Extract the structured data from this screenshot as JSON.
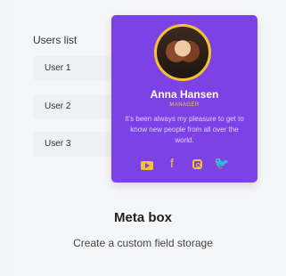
{
  "users_list": {
    "title": "Users list",
    "items": [
      {
        "label": "User 1"
      },
      {
        "label": "User 2"
      },
      {
        "label": "User 3"
      }
    ]
  },
  "profile": {
    "name": "Anna Hansen",
    "role": "MANAGER",
    "bio": "It's been always my pleasure to get to know new people from all over the world.",
    "socials": [
      "youtube-icon",
      "facebook-icon",
      "instagram-icon",
      "twitter-icon"
    ],
    "accent_color": "#f4c430",
    "card_color": "#7d42e5"
  },
  "footer": {
    "title": "Meta box",
    "subtitle": "Create a custom field storage"
  }
}
